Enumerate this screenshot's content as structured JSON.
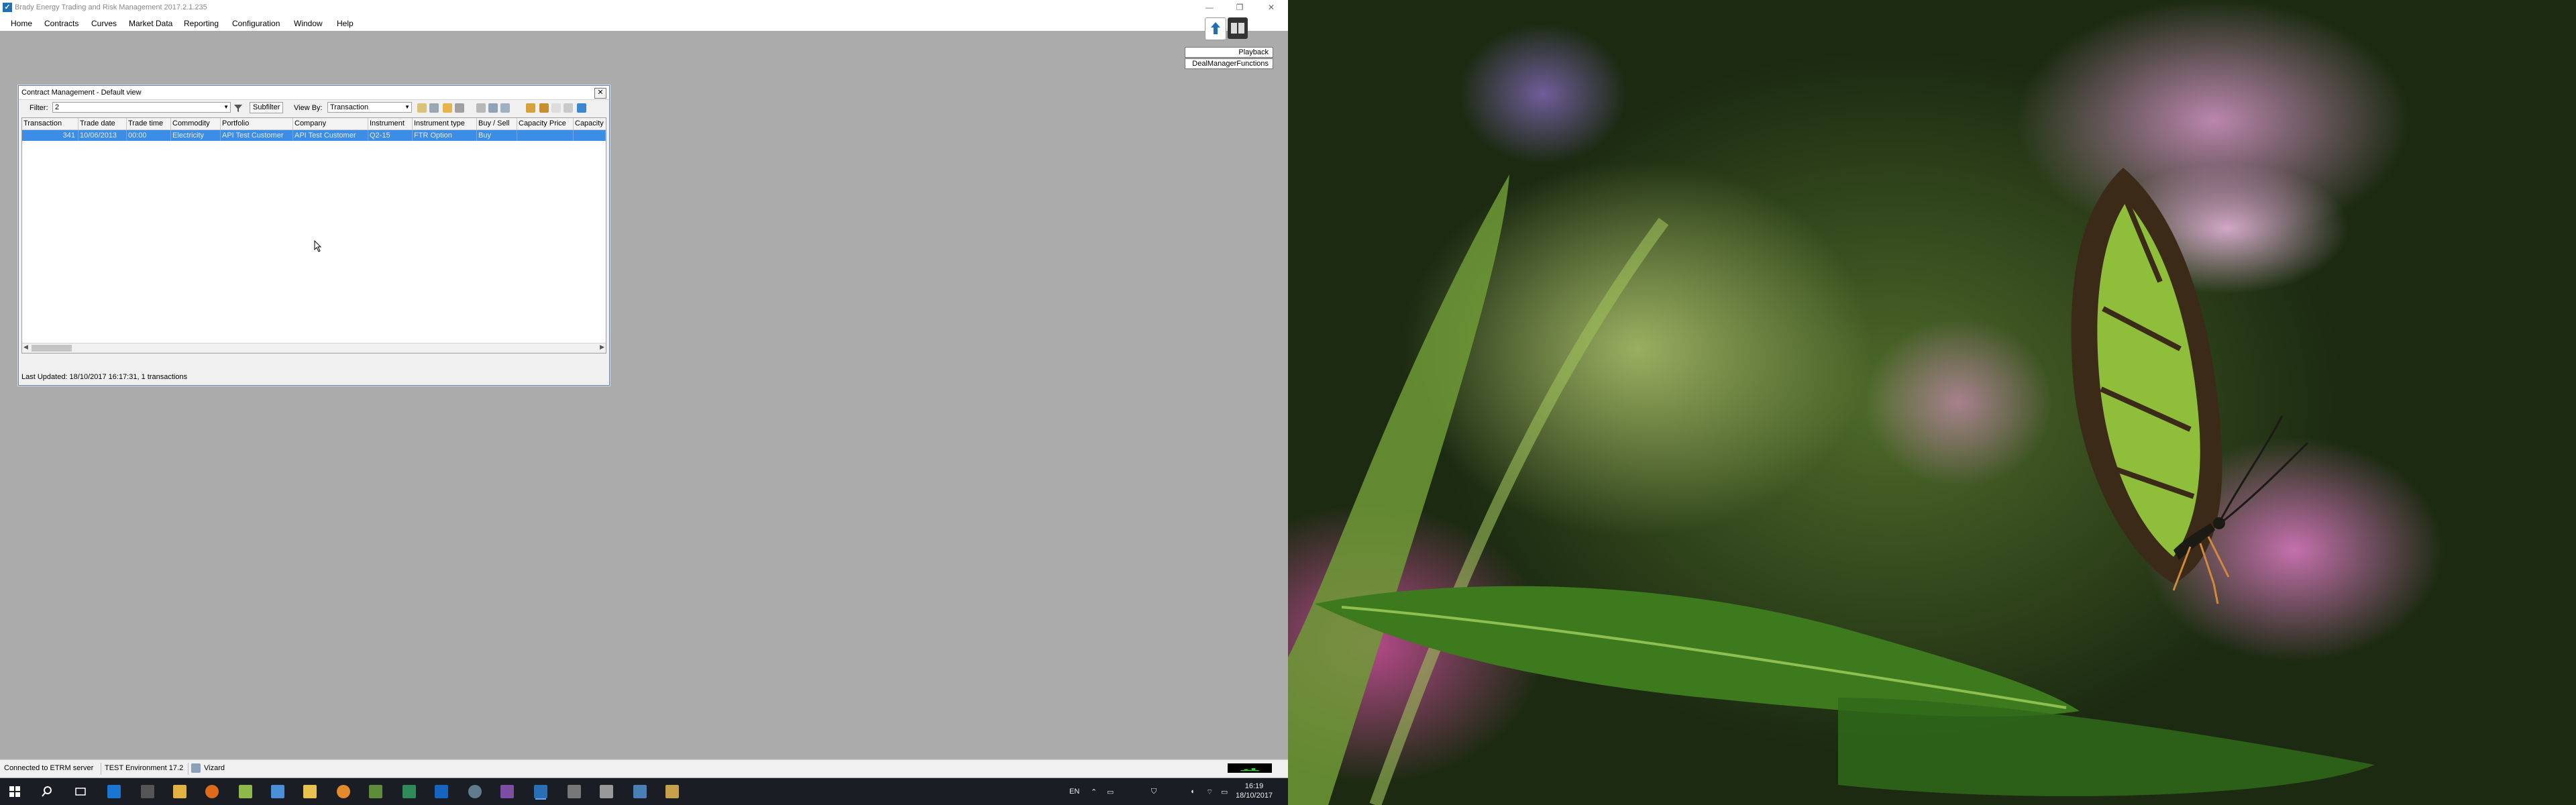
{
  "app": {
    "title": "Brady Energy Trading and Risk Management 2017.2.1.235",
    "menu": [
      "Home",
      "Contracts",
      "Curves",
      "Market Data",
      "Reporting",
      "Configuration",
      "Window",
      "Help"
    ],
    "playback_label": "Playback",
    "dealmanager_label": "DealManagerFunctions"
  },
  "contract_window": {
    "title": "Contract Management - Default view",
    "filter_label": "Filter:",
    "filter_value": "2",
    "subfilter_label": "Subfilter",
    "viewby_label": "View By:",
    "viewby_value": "Transaction",
    "columns": [
      "Transaction",
      "Trade date",
      "Trade time",
      "Commodity",
      "Portfolio",
      "Company",
      "Instrument",
      "Instrument type",
      "Buy / Sell",
      "Capacity Price",
      "Capacity"
    ],
    "rows": [
      [
        "341",
        "10/06/2013",
        "00:00",
        "Electricity",
        "API Test Customer",
        "API Test Customer",
        "Q2-15",
        "FTR Option",
        "Buy",
        "",
        ""
      ]
    ],
    "status": "Last Updated: 18/10/2017 16:17:31, 1 transactions"
  },
  "statusbar": {
    "connection": "Connected to ETRM server",
    "environment": "TEST Environment 17.2",
    "wizard": "Vizard"
  },
  "taskbar": {
    "language": "EN",
    "time": "16:19",
    "date": "18/10/2017"
  },
  "colors": {
    "selection": "#3c8de6",
    "taskbar": "#1b1d25",
    "desktop": "#ababab"
  }
}
